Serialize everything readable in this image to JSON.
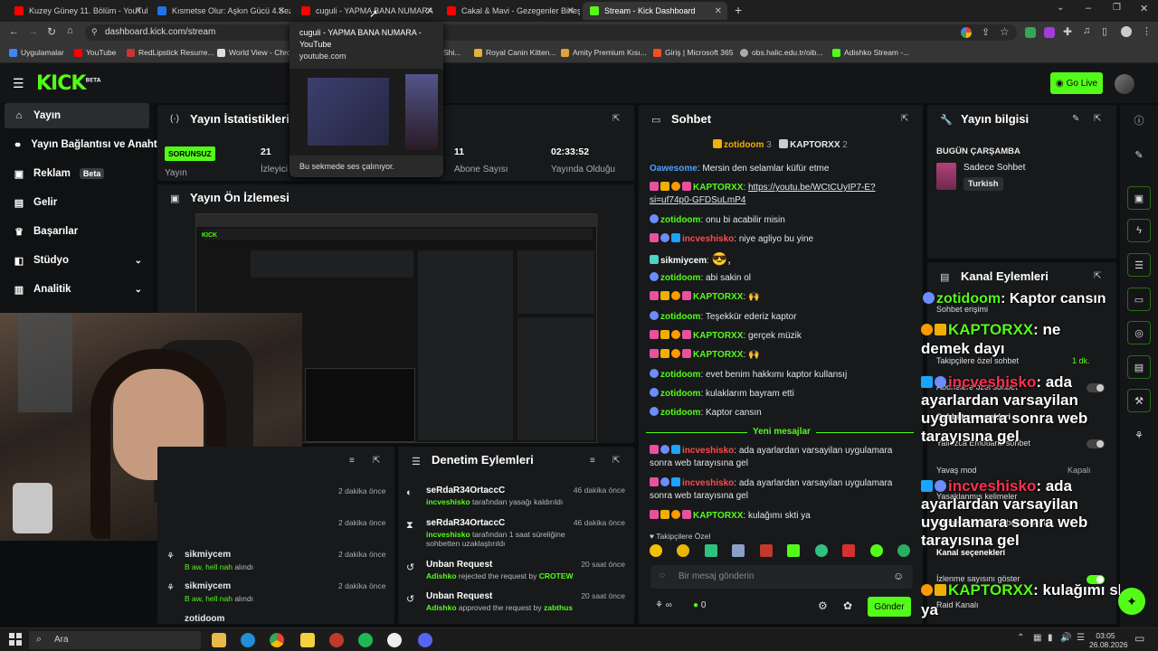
{
  "browser": {
    "tabs": [
      {
        "label": "Kuzey Güney 11. Bölüm - YouTube",
        "color": "#ff0000"
      },
      {
        "label": "Kısmetse Olur: Aşkın Gücü 4.Sezon",
        "color": "#1e73e8"
      },
      {
        "label": "cuguli - YAPMA BANA NUMARA",
        "color": "#ff0000"
      },
      {
        "label": "Cakal & Mavi - Gezegenler Birleşiyor",
        "color": "#ff0000"
      },
      {
        "label": "Stream - Kick Dashboard",
        "color": "#53fc18"
      }
    ],
    "url": "dashboard.kick.com/stream",
    "bookmarks": [
      "Uygulamalar",
      "YouTube",
      "RedLipstick Resurre...",
      "World View - Chro...",
      "Shi...",
      "Royal Canin Kitten...",
      "Amity Premium Kısı...",
      "Giriş | Microsoft 365",
      "obs.halic.edu.tr/oib...",
      "Adishko Stream -..."
    ],
    "tooltip": {
      "title": "cuguli - YAPMA BANA NUMARA - YouTube",
      "domain": "youtube.com",
      "note": "Bu sekmede ses çalınıyor."
    }
  },
  "header": {
    "logo": "KICK",
    "logo_sup": "BETA",
    "go_live": "Go Live"
  },
  "sidebar": {
    "items": [
      {
        "label": "Yayın",
        "icon": "home-icon"
      },
      {
        "label": "Yayın Bağlantısı ve Anahtarı",
        "icon": "link-icon"
      },
      {
        "label": "Reklam",
        "icon": "ad-icon",
        "badge": "Beta"
      },
      {
        "label": "Gelir",
        "icon": "wallet-icon"
      },
      {
        "label": "Başarılar",
        "icon": "trophy-icon"
      },
      {
        "label": "Stüdyo",
        "icon": "studio-icon"
      },
      {
        "label": "Analitik",
        "icon": "chart-icon"
      }
    ]
  },
  "stats": {
    "title": "Yayın İstatistikleri",
    "status": "SORUNSUZ",
    "status_label": "Yayın",
    "viewers_value": "21",
    "viewers_label": "İzleyici",
    "subs_value": "11",
    "subs_label": "Abone Sayısı",
    "uptime_value": "02:33:52",
    "uptime_label": "Yayında Olduğu"
  },
  "preview": {
    "title": "Yayın Ön İzlemesi"
  },
  "mod_actions": {
    "title": "Denetim Eylemleri",
    "items": [
      {
        "title": "seRdaR34OrtaccC",
        "user": "incveshisko",
        "text": "tarafından yasağı kaldırıldı",
        "time": "46 dakika önce"
      },
      {
        "title": "seRdaR34OrtaccC",
        "user": "incveshisko",
        "text": "tarafından 1 saat süreliğine sohbetten uzaklaştırıldı",
        "time": "46 dakika önce"
      },
      {
        "title": "Unban Request",
        "user": "Adishko",
        "text": "rejected the request by",
        "target": "CROTEW",
        "time": "20 saat önce"
      },
      {
        "title": "Unban Request",
        "user": "Adishko",
        "text": "approved the request by",
        "target": "zabthus",
        "time": "20 saat önce"
      }
    ]
  },
  "activity": {
    "times": [
      "2 dakika önce",
      "2 dakika önce",
      "2 dakika önce",
      "2 dakika önce"
    ],
    "items": [
      {
        "user": "sikmiycem",
        "text": "B aw, hell nah",
        "suffix": "alındı"
      },
      {
        "user": "sikmiycem",
        "text": "B aw, hell nah",
        "suffix": "alındı"
      }
    ],
    "last": "zotidoom"
  },
  "chat": {
    "title": "Sohbet",
    "pinned": [
      {
        "user": "zotidoom",
        "count": "3"
      },
      {
        "user": "KAPTORXX",
        "count": "2"
      }
    ],
    "messages": [
      {
        "user": "Oawesome",
        "color": "#4aa3ff",
        "text": "Mersin den selamlar küfür etme"
      },
      {
        "user": "KAPTORXX",
        "color": "#53fc18",
        "text": "https://youtu.be/WCtCUyIP7-E?si=uf74p0-GFDSuLmP4"
      },
      {
        "user": "zotidoom",
        "color": "#53fc18",
        "text": "onu bi acabilir misin"
      },
      {
        "user": "incveshisko",
        "color": "#ff4b4b",
        "text": "niye agliyo bu yine"
      },
      {
        "user": "sikmiycem",
        "color": "#ffffff",
        "text": "😎,"
      },
      {
        "user": "zotidoom",
        "color": "#53fc18",
        "text": "abi sakin ol"
      },
      {
        "user": "KAPTORXX",
        "color": "#53fc18",
        "text": "🙌"
      },
      {
        "user": "zotidoom",
        "color": "#53fc18",
        "text": "Teşekkür ederiz kaptor"
      },
      {
        "user": "KAPTORXX",
        "color": "#53fc18",
        "text": "gerçek müzik"
      },
      {
        "user": "KAPTORXX",
        "color": "#53fc18",
        "text": "🙌"
      },
      {
        "user": "zotidoom",
        "color": "#53fc18",
        "text": "evet benim hakkımı kaptor kullansıj"
      },
      {
        "user": "zotidoom",
        "color": "#53fc18",
        "text": "kulaklarım bayram etti"
      },
      {
        "user": "zotidoom",
        "color": "#53fc18",
        "text": "Kaptor cansın"
      }
    ],
    "new_messages": "Yeni mesajlar",
    "new": [
      {
        "user": "incveshisko",
        "color": "#ff4b4b",
        "text": "ada ayarlardan varsayilan uygulamara sonra web tarayısına gel"
      },
      {
        "user": "incveshisko",
        "color": "#ff4b4b",
        "text": "ada ayarlardan varsayilan uygulamara sonra web tarayısına gel"
      },
      {
        "user": "KAPTORXX",
        "color": "#53fc18",
        "text": "kulağımı skti ya"
      }
    ],
    "followers_only": "Takipçilere Özel",
    "input_placeholder": "Bir mesaj gönderin",
    "points": "∞",
    "zero": "0",
    "send": "Gönder"
  },
  "stream_info": {
    "title": "Yayın bilgisi",
    "day": "BUGÜN ÇARŞAMBA",
    "category": "Sadece Sohbet",
    "language": "Turkish"
  },
  "channel_actions": {
    "title": "Kanal Eylemleri",
    "rows": [
      {
        "label": "Sohbet erişimi",
        "value": ""
      },
      {
        "label": "Takipçilere özel sohbet",
        "value": "1 dk."
      },
      {
        "label": "Abonelere özel sohbet",
        "value": ""
      },
      {
        "label": "Sohbet seçenekleri",
        "value": ""
      },
      {
        "label": "Yalnızca Emotlarla sohbet",
        "value": ""
      },
      {
        "label": "Yavaş mod",
        "value": "Kapalı"
      },
      {
        "label": "Yasaklanmış kelimeler",
        "value": ""
      },
      {
        "label": "Yapay Zeka ile Sohbet Denetimi",
        "value": ""
      },
      {
        "label": "Kanal seçenekleri",
        "value": ""
      },
      {
        "label": "İzlenme sayısını göster",
        "value": ""
      },
      {
        "label": "Raid Kanalı",
        "value": ""
      }
    ]
  },
  "overlay": [
    {
      "user": "zotidoom",
      "text": ": Kaptor cansın"
    },
    {
      "user": "KAPTORXX",
      "text": ": ne demek dayı"
    },
    {
      "user": "incveshisko",
      "text": ": ada ayarlardan varsayilan uygulamara sonra web tarayısına gel"
    },
    {
      "user": "incveshisko",
      "text": ": ada ayarlardan varsayilan uygulamara sonra web tarayısına gel"
    },
    {
      "user": "KAPTORXX",
      "text": ": kulağımı skti ya"
    }
  ],
  "taskbar": {
    "search": "Ara",
    "time": "03:05",
    "date": "26.08.2026"
  },
  "colors": {
    "brand": "#53fc18",
    "panel": "#17191b",
    "bg": "#0b0e0f"
  }
}
